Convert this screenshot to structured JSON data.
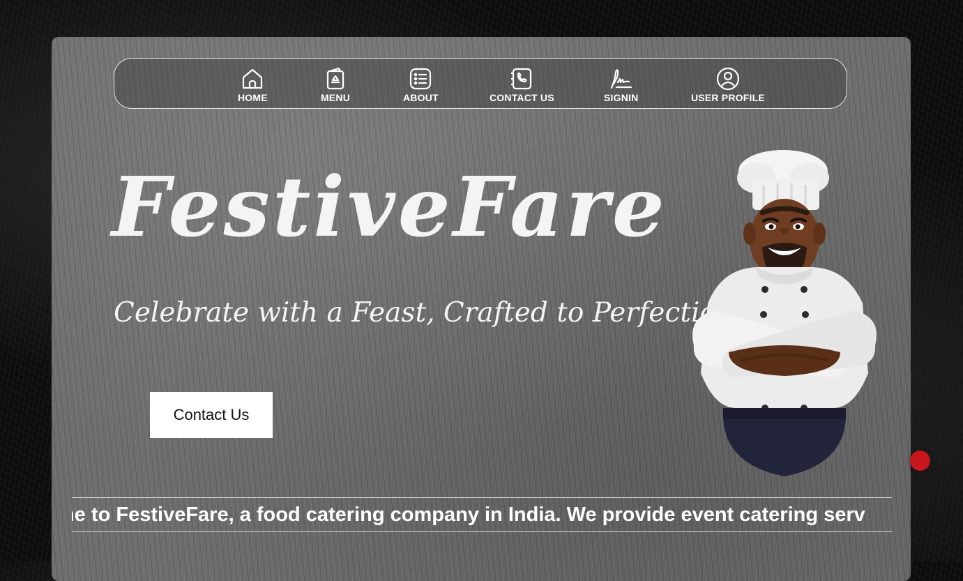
{
  "nav": {
    "items": [
      {
        "label": "HOME",
        "icon": "home-icon"
      },
      {
        "label": "MENU",
        "icon": "menu-card-icon"
      },
      {
        "label": "ABOUT",
        "icon": "list-icon"
      },
      {
        "label": "CONTACT US",
        "icon": "phone-icon"
      },
      {
        "label": "SIGNIN",
        "icon": "signature-icon"
      },
      {
        "label": "USER PROFILE",
        "icon": "user-icon"
      }
    ]
  },
  "hero": {
    "brand": "FestiveFare",
    "tagline": "Celebrate with a Feast, Crafted to Perfection",
    "cta_label": "Contact Us",
    "illustration": "chef-illustration"
  },
  "marquee": {
    "text": "me to FestiveFare, a food catering company in India. We provide event catering serv"
  },
  "colors": {
    "panel": "#6e6e6e",
    "text": "#ffffff",
    "dot": "#c8161d"
  }
}
